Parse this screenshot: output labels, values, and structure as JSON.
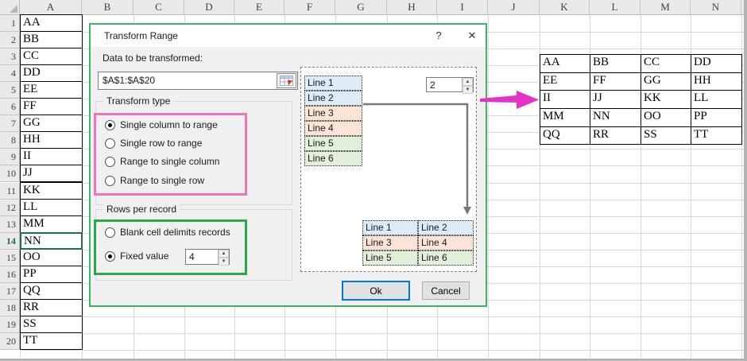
{
  "spreadsheet": {
    "columns": [
      "A",
      "B",
      "C",
      "D",
      "E",
      "F",
      "G",
      "H",
      "I",
      "J",
      "K",
      "L",
      "M",
      "N"
    ],
    "row_numbers": [
      "1",
      "2",
      "3",
      "4",
      "5",
      "6",
      "7",
      "8",
      "9",
      "10",
      "11",
      "12",
      "13",
      "14",
      "15",
      "16",
      "17",
      "18",
      "19",
      "20"
    ],
    "column_a_values": [
      "AA",
      "BB",
      "CC",
      "DD",
      "EE",
      "FF",
      "GG",
      "HH",
      "II",
      "JJ",
      "KK",
      "LL",
      "MM",
      "NN",
      "OO",
      "PP",
      "QQ",
      "RR",
      "SS",
      "TT"
    ],
    "active_row": 14,
    "output_grid": [
      [
        "AA",
        "BB",
        "CC",
        "DD"
      ],
      [
        "EE",
        "FF",
        "GG",
        "HH"
      ],
      [
        "II",
        "JJ",
        "KK",
        "LL"
      ],
      [
        "MM",
        "NN",
        "OO",
        "PP"
      ],
      [
        "QQ",
        "RR",
        "SS",
        "TT"
      ]
    ]
  },
  "dialog": {
    "title": "Transform Range",
    "help_label": "?",
    "close_label": "✕",
    "data_label": "Data to be transformed:",
    "range_value": "$A$1:$A$20",
    "transform_type": {
      "label": "Transform type",
      "options": [
        {
          "label": "Single column to range",
          "selected": true
        },
        {
          "label": "Single row to range",
          "selected": false
        },
        {
          "label": "Range to single column",
          "selected": false
        },
        {
          "label": "Range to single row",
          "selected": false
        }
      ]
    },
    "rows_per_record": {
      "label": "Rows per record",
      "options": [
        {
          "label": "Blank cell delimits records",
          "selected": false
        },
        {
          "label": "Fixed value",
          "selected": true
        }
      ],
      "fixed_value": "4"
    },
    "preview": {
      "lines": [
        "Line 1",
        "Line 2",
        "Line 3",
        "Line 4",
        "Line 5",
        "Line 6"
      ],
      "line_colors": [
        "#ddebf7",
        "#ddebf7",
        "#fce4d6",
        "#fce4d6",
        "#e2efda",
        "#e2efda"
      ],
      "count_value": "2",
      "result_rows": [
        [
          "Line 1",
          "Line 2"
        ],
        [
          "Line 3",
          "Line 4"
        ],
        [
          "Line 5",
          "Line 6"
        ]
      ],
      "result_colors": [
        "#ddebf7",
        "#fce4d6",
        "#e2efda"
      ]
    },
    "ok_label": "Ok",
    "cancel_label": "Cancel"
  },
  "icons": {
    "spin_up": "▲",
    "spin_down": "▼"
  },
  "annotation": {
    "arrow_color": "#e531c6",
    "highlight_pink": "#ee74ba",
    "highlight_green": "#2aa74a",
    "dialog_border": "#3cb26a",
    "excel_green": "#1e7145"
  }
}
